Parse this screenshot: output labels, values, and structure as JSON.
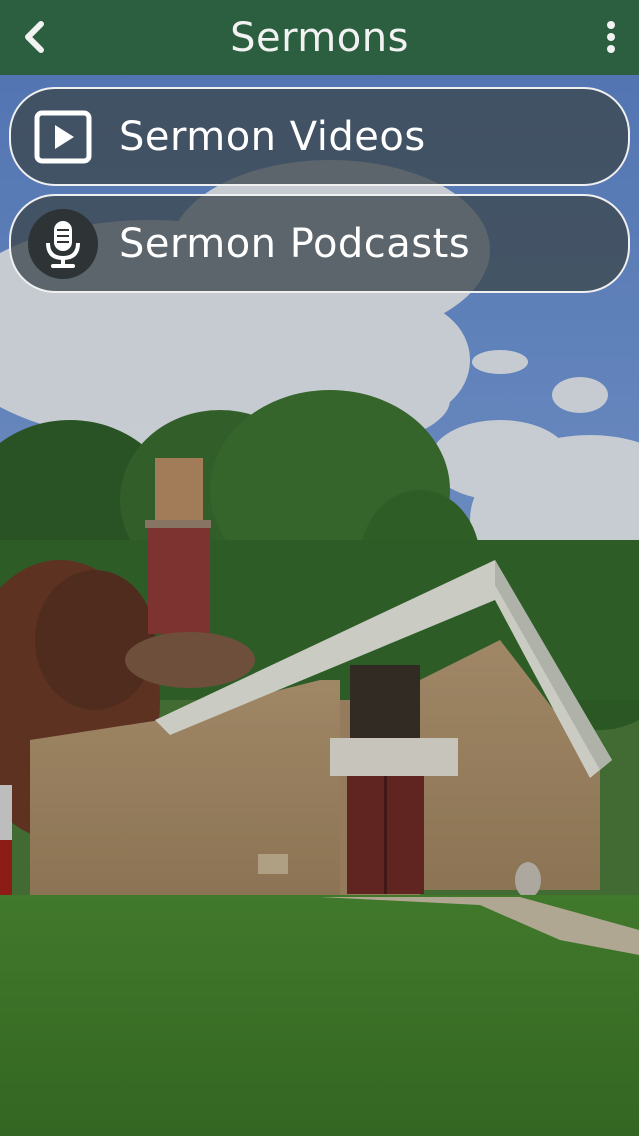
{
  "header": {
    "title": "Sermons",
    "back_icon": "chevron-left-icon",
    "menu_icon": "more-vertical-icon"
  },
  "menu": {
    "items": [
      {
        "label": "Sermon Videos",
        "icon": "play-video-icon"
      },
      {
        "label": "Sermon Podcasts",
        "icon": "microphone-icon"
      }
    ]
  },
  "background": {
    "description_icon": "church-photo"
  },
  "colors": {
    "header_bg": "#2c5f3f",
    "button_bg": "#3c484e",
    "button_border": "#f0f0f0",
    "text": "#ffffff"
  }
}
